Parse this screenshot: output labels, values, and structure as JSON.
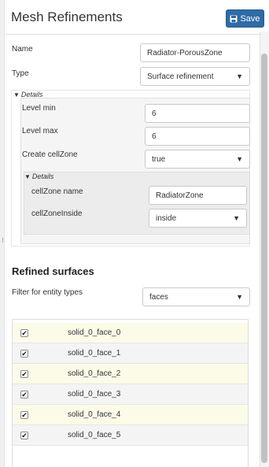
{
  "header": {
    "title": "Mesh Refinements",
    "save_label": "Save"
  },
  "form": {
    "name_label": "Name",
    "name_value": "Radiator-PorousZone",
    "type_label": "Type",
    "type_value": "Surface refinement",
    "details_label": "Details",
    "level_min_label": "Level min",
    "level_min_value": "6",
    "level_max_label": "Level max",
    "level_max_value": "6",
    "create_cellzone_label": "Create cellZone",
    "create_cellzone_value": "true",
    "inner_details_label": "Details",
    "cellzone_name_label": "cellZone name",
    "cellzone_name_value": "RadiatorZone",
    "cellzone_inside_label": "cellZoneInside",
    "cellzone_inside_value": "inside"
  },
  "refined_surfaces": {
    "title": "Refined surfaces",
    "filter_label": "Filter for entity types",
    "filter_value": "faces",
    "items": [
      {
        "label": "solid_0_face_0",
        "checked": "✔"
      },
      {
        "label": "solid_0_face_1",
        "checked": "✔"
      },
      {
        "label": "solid_0_face_2",
        "checked": "✔"
      },
      {
        "label": "solid_0_face_3",
        "checked": "✔"
      },
      {
        "label": "solid_0_face_4",
        "checked": "✔"
      },
      {
        "label": "solid_0_face_5",
        "checked": "✔"
      }
    ]
  },
  "icons": {
    "save": "floppy-disk-icon",
    "dropdown": "chevron-down-icon",
    "collapse": "triangle-down-icon"
  },
  "colors": {
    "primary_button": "#2f6ba6",
    "row_highlight": "#fbfbe8"
  }
}
